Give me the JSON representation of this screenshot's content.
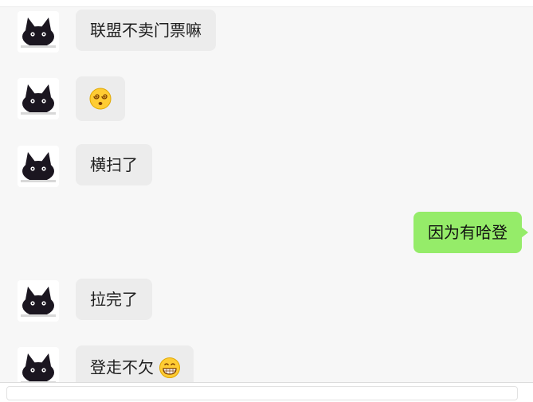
{
  "messages": [
    {
      "side": "left",
      "text": "联盟不卖门票嘛"
    },
    {
      "side": "left",
      "emoji": "dizzy-face-emoji"
    },
    {
      "side": "left",
      "text": "横扫了"
    },
    {
      "side": "right",
      "text": "因为有哈登"
    },
    {
      "side": "left",
      "text": "拉完了"
    },
    {
      "side": "left",
      "text": "登走不欠",
      "emoji": "grinning-face-emoji"
    }
  ],
  "colors": {
    "chat_background": "#f7f7f7",
    "left_bubble": "#ececec",
    "right_bubble": "#95ec69",
    "text": "#1f1f1f"
  }
}
